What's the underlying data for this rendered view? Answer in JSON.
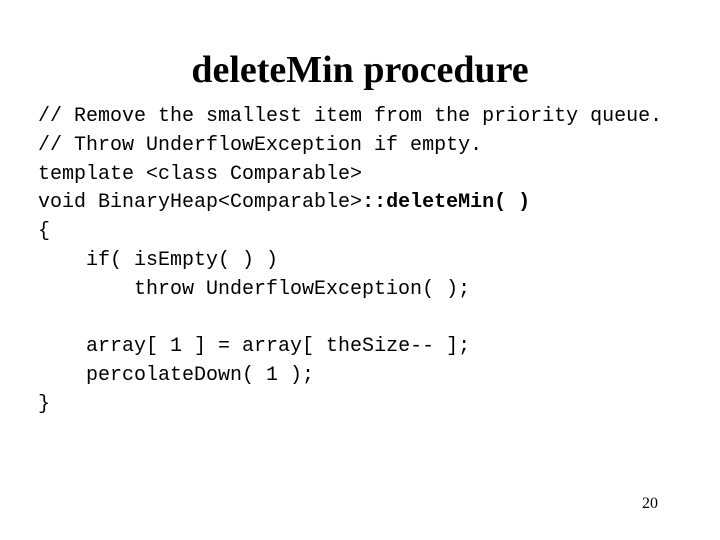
{
  "slide": {
    "title": "deleteMin procedure",
    "page_number": "20"
  },
  "code": {
    "lines": [
      {
        "indent": "",
        "text": "// Remove the smallest item from the priority queue.",
        "bold": "",
        "after": ""
      },
      {
        "indent": "",
        "text": "// Throw UnderflowException if empty.",
        "bold": "",
        "after": ""
      },
      {
        "indent": "",
        "text": "template <class Comparable>",
        "bold": "",
        "after": ""
      },
      {
        "indent": "",
        "text": "void BinaryHeap<Comparable>",
        "bold": "::deleteMin( )",
        "after": ""
      },
      {
        "indent": "",
        "text": "{",
        "bold": "",
        "after": ""
      },
      {
        "indent": "    ",
        "text": "if( isEmpty( ) )",
        "bold": "",
        "after": ""
      },
      {
        "indent": "        ",
        "text": "throw UnderflowException( );",
        "bold": "",
        "after": ""
      },
      {
        "indent": "",
        "text": "",
        "bold": "",
        "after": ""
      },
      {
        "indent": "    ",
        "text": "array[ 1 ] = array[ theSize-- ];",
        "bold": "",
        "after": ""
      },
      {
        "indent": "    ",
        "text": "percolateDown( 1 );",
        "bold": "",
        "after": ""
      },
      {
        "indent": "",
        "text": "}",
        "bold": "",
        "after": ""
      }
    ]
  }
}
